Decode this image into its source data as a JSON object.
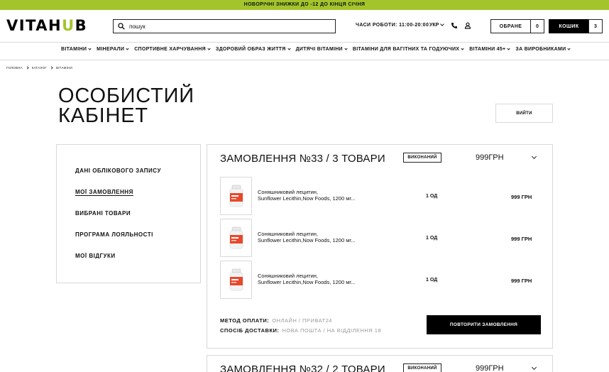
{
  "promo": "НОВОРІЧНІ ЗНИЖКИ ДО -12 ДО КІНЦЯ СІЧНЯ",
  "header": {
    "logo_main": "VITAH",
    "logo_accent": "U",
    "logo_end": "B",
    "search_placeholder": "пошук",
    "hours": "ЧАСИ РОБОТИ: 11:00-20:00",
    "lang": "УКР",
    "fav_label": "ОБРАНЕ",
    "fav_count": "0",
    "cart_label": "КОШИК",
    "cart_count": "3"
  },
  "nav": [
    {
      "label": "ВІТАМІНИ"
    },
    {
      "label": "МІНЕРАЛИ"
    },
    {
      "label": "СПОРТИВНЕ ХАРЧУВАННЯ"
    },
    {
      "label": "ЗДОРОВИЙ ОБРАЗ ЖИТТЯ"
    },
    {
      "label": "ДИТЯЧІ ВІТАМІНИ"
    },
    {
      "label": "ВІТАМІНИ ДЛЯ ВАГІТНИХ ТА ГОДУЮЧИХ"
    },
    {
      "label": "ВІТАМІНИ 45+"
    },
    {
      "label": "ЗА ВИРОБНИКАМИ"
    }
  ],
  "breadcrumbs": [
    "ГОЛОВНА",
    "КАТАЛОГ",
    "ВІТАМІНИ"
  ],
  "page": {
    "title_line1": "ОСОБИСТИЙ",
    "title_line2": "КАБІНЕТ",
    "logout": "ВИЙТИ"
  },
  "sidebar": [
    {
      "label": "ДАНІ ОБЛІКОВОГО ЗАПИСУ"
    },
    {
      "label": "МОЇ ЗАМОВЛЕННЯ"
    },
    {
      "label": "ВИБРАНІ ТОВАРИ"
    },
    {
      "label": "ПРОГРАМА ЛОЯЛЬНОСТІ"
    },
    {
      "label": "МОЇ ВІДГУКИ"
    }
  ],
  "orders": [
    {
      "title": "ЗАМОВЛЕННЯ №33 / 3 ТОВАРИ",
      "status": "ВИКОНАНИЙ",
      "total": "999ГРН",
      "items": [
        {
          "name_line1": "Соняшниковий лецитин,",
          "name_line2": "Sunflower Lecithin,Now Foods, 1200 мг...",
          "qty": "1 ОД",
          "price": "999 ГРН"
        },
        {
          "name_line1": "Соняшниковий лецитин,",
          "name_line2": "Sunflower Lecithin,Now Foods, 1200 мг...",
          "qty": "1 ОД",
          "price": "999 ГРН"
        },
        {
          "name_line1": "Соняшниковий лецитин,",
          "name_line2": "Sunflower Lecithin,Now Foods, 1200 мг...",
          "qty": "1 ОД",
          "price": "999 ГРН"
        }
      ],
      "payment_label": "МЕТОД ОПЛАТИ:",
      "payment_value": "ОНЛАЙН / ПРИВАТ24",
      "delivery_label": "СПОСІБ ДОСТАВКИ:",
      "delivery_value": "НОВА ПОШТА / НА ВІДДІЛЕННЯ 18",
      "repeat": "ПОВТОРИТИ ЗАМОВЛЕННЯ"
    },
    {
      "title": "ЗАМОВЛЕННЯ №32 / 2 ТОВАРИ",
      "status": "ВИКОНАНИЙ",
      "total": "999ГРН"
    }
  ],
  "colors": {
    "accent": "#a3c52b",
    "border": "#d9d9d9",
    "muted": "#9a9a9a"
  }
}
